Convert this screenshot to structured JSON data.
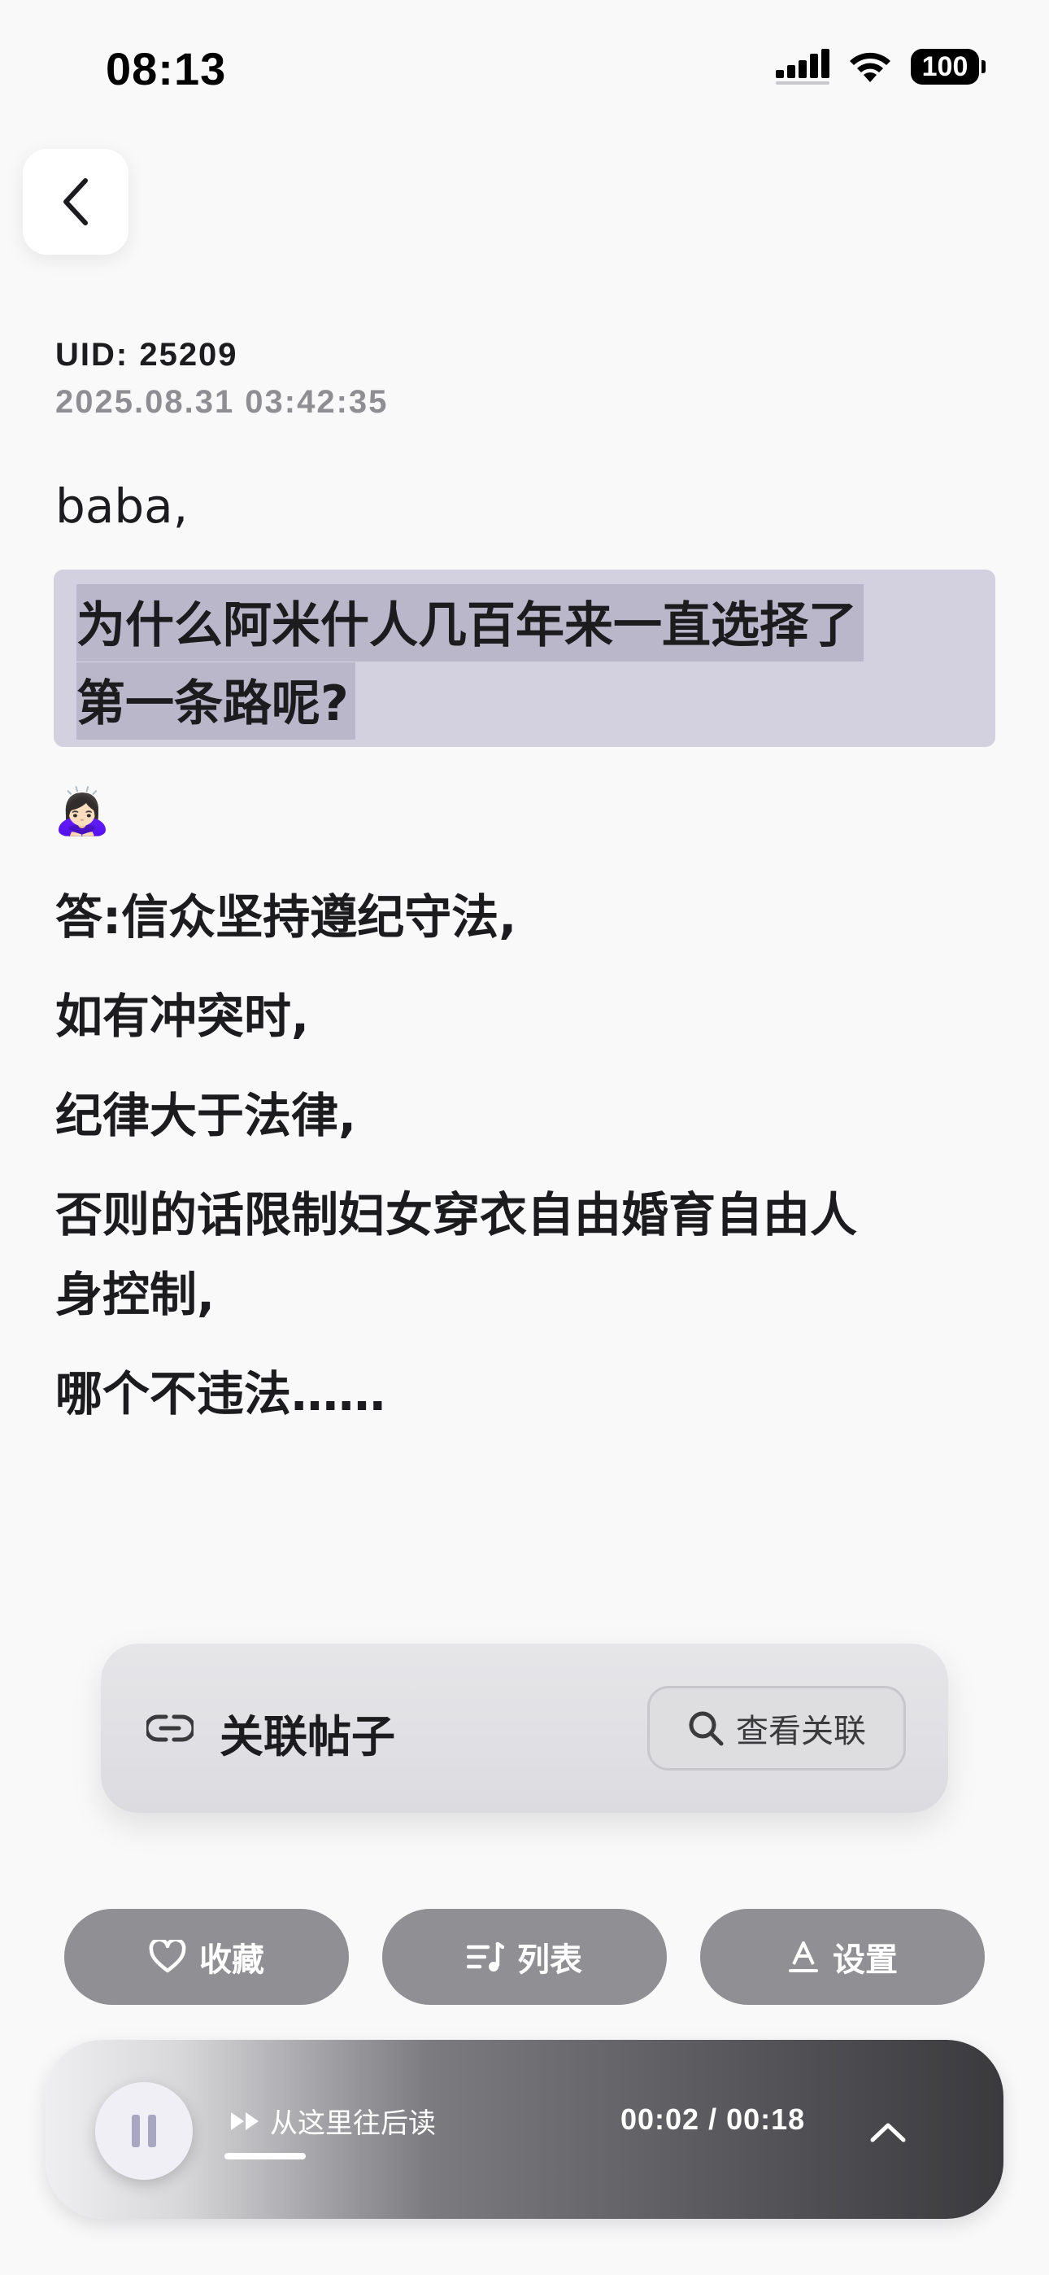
{
  "status_bar": {
    "time": "08:13",
    "battery": "100"
  },
  "post": {
    "uid": "UID: 25209",
    "date": "2025.08.31 03:42:35",
    "greeting": "baba,",
    "question_lines": [
      "为什么阿米什人几百年来一直选择了",
      "第一条路呢?"
    ],
    "emoji": "🙇🏻‍♀️",
    "answer_lines": [
      "答:信众坚持遵纪守法,",
      "如有冲突时,",
      "纪律大于法律,",
      "否则的话限制妇女穿衣自由婚育自由人",
      "身控制,",
      "哪个不违法……"
    ]
  },
  "related": {
    "title": "关联帖子",
    "view_label": "查看关联"
  },
  "actions": {
    "favorite": "收藏",
    "list": "列表",
    "settings": "设置"
  },
  "player": {
    "read_label": "从这里往后读",
    "time": "00:02 / 00:18",
    "progress": 0.11
  },
  "colors": {
    "highlight": "#d3d1df",
    "pill": "#8f8f94",
    "accent": "#a9a6c1"
  }
}
